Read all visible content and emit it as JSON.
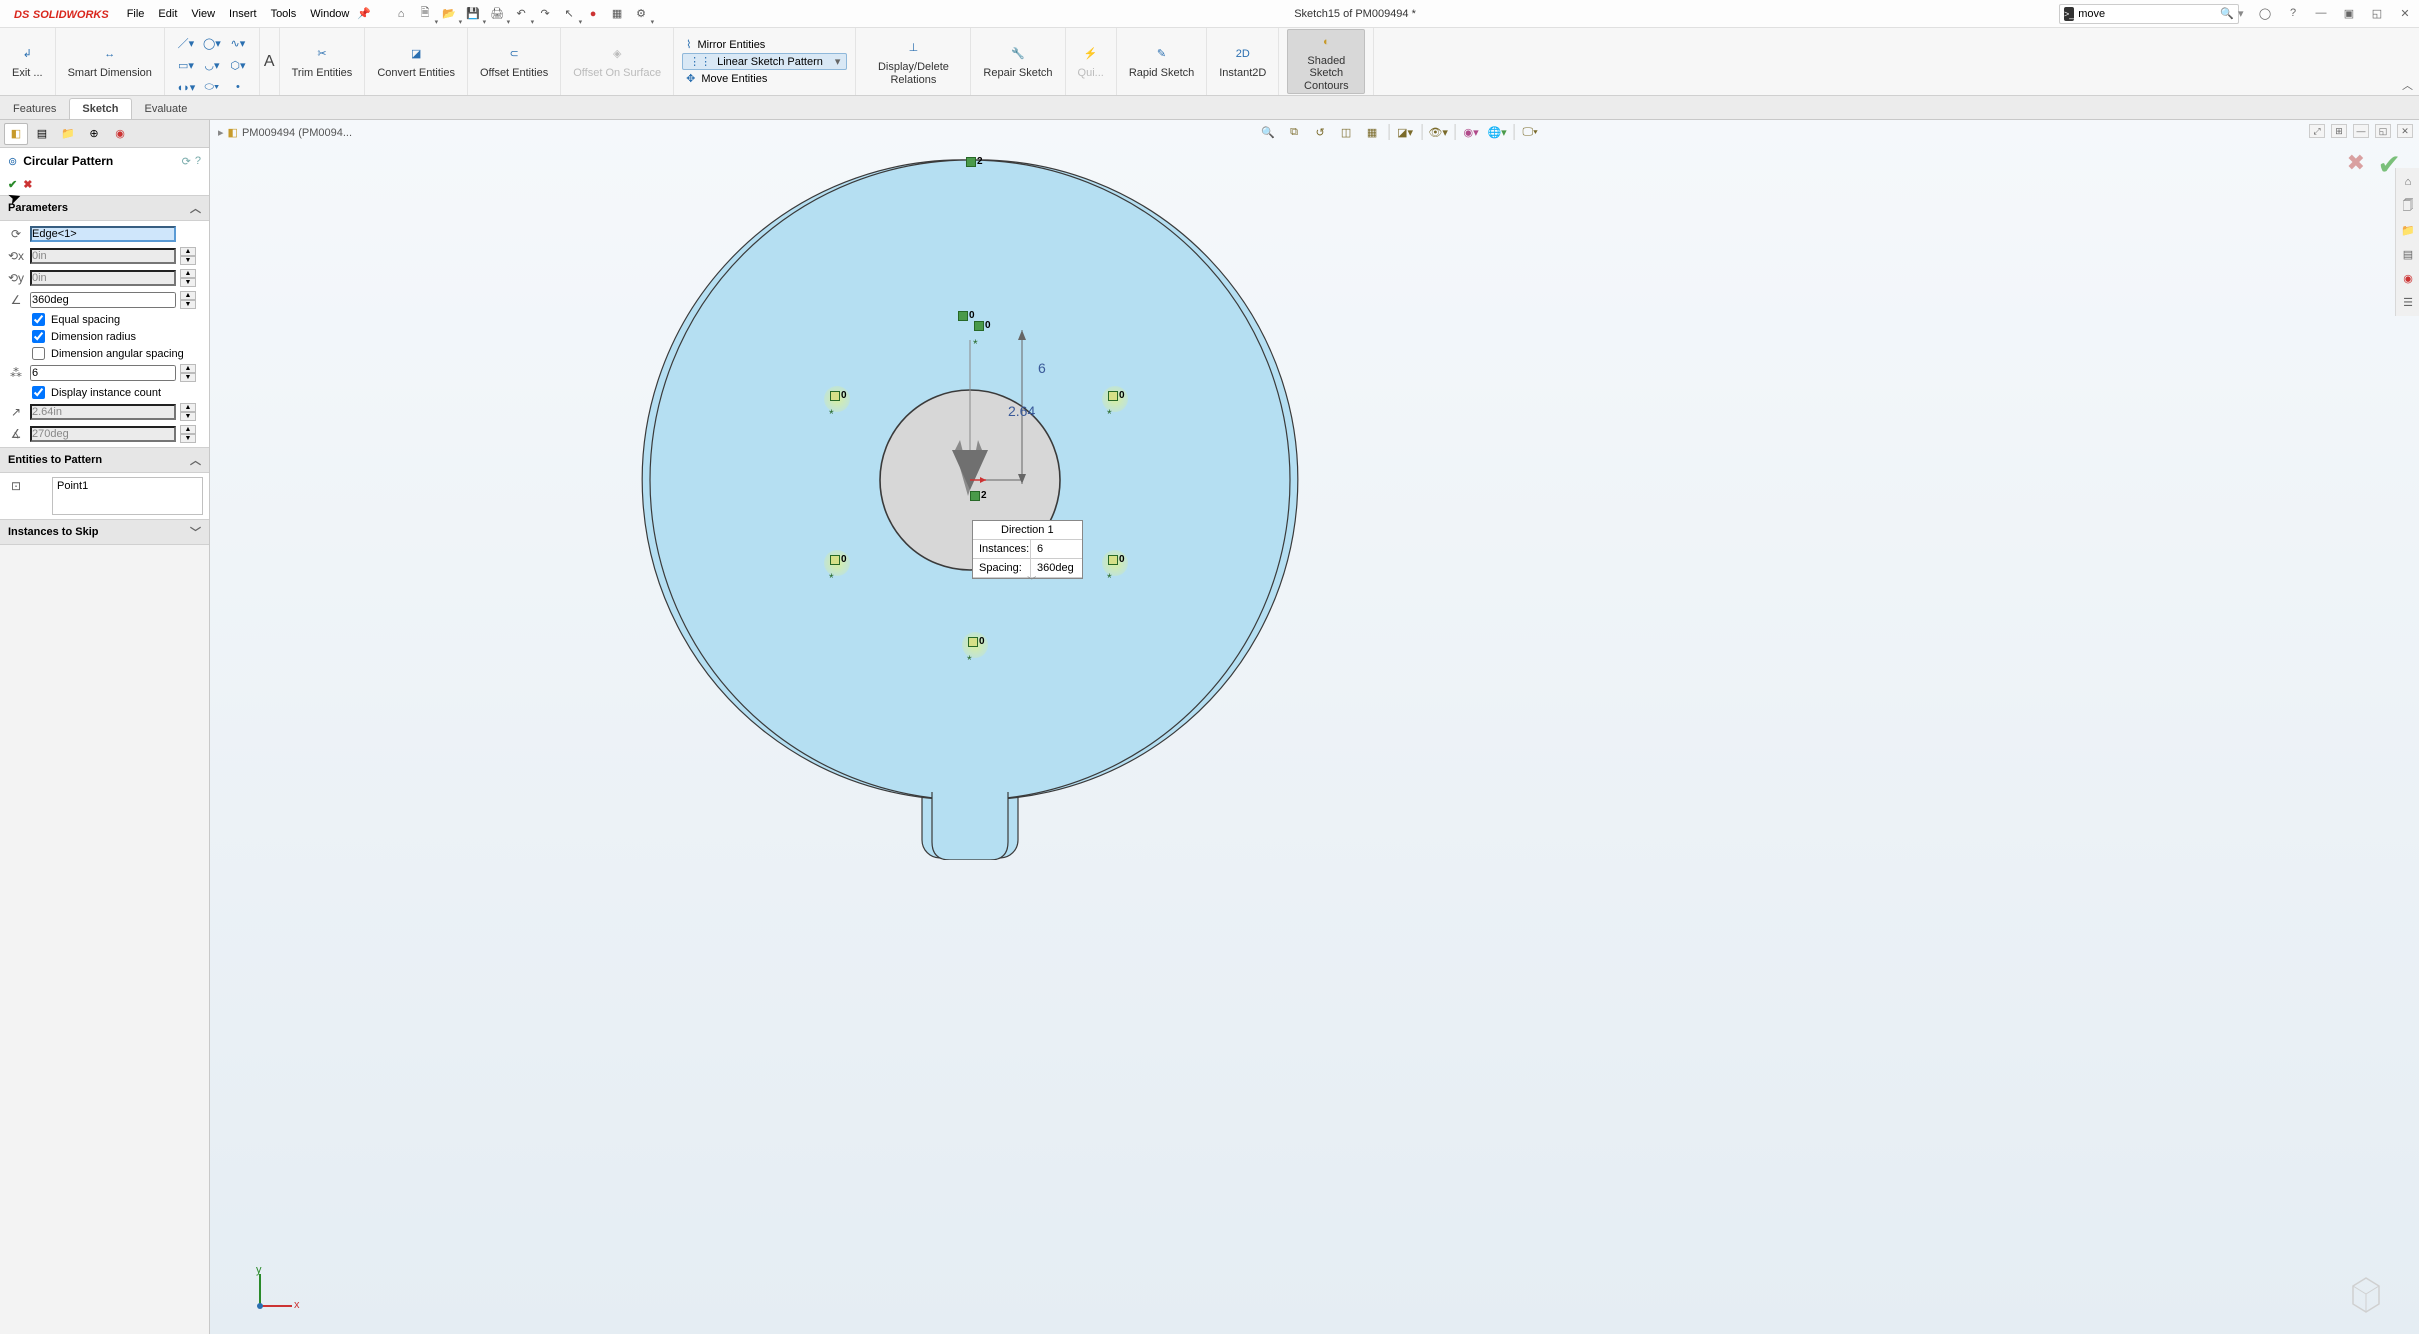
{
  "app": {
    "logo_prefix": "DS",
    "logo_name": "SOLIDWORKS"
  },
  "menu": [
    "File",
    "Edit",
    "View",
    "Insert",
    "Tools",
    "Window"
  ],
  "doc_title": "Sketch15 of PM009494 *",
  "search": {
    "value": "move"
  },
  "ribbon": {
    "exit": "Exit ...",
    "smart_dim": "Smart Dimension",
    "trim": "Trim Entities",
    "convert": "Convert Entities",
    "offset": "Offset Entities",
    "offset_surface": "Offset On Surface",
    "mirror": "Mirror Entities",
    "linear_pattern": "Linear Sketch Pattern",
    "move": "Move Entities",
    "relations": "Display/Delete Relations",
    "repair": "Repair Sketch",
    "quick": "Qui...",
    "rapid": "Rapid Sketch",
    "instant": "Instant2D",
    "shaded": "Shaded Sketch Contours"
  },
  "tabs": [
    "Features",
    "Sketch",
    "Evaluate"
  ],
  "active_tab": "Sketch",
  "breadcrumb": "PM009494 (PM0094...",
  "pm": {
    "title": "Circular Pattern",
    "sections": {
      "parameters": "Parameters",
      "entities": "Entities to Pattern",
      "skip": "Instances to Skip"
    },
    "axis": "Edge<1>",
    "offset_x": "0in",
    "offset_y": "0in",
    "angle": "360deg",
    "equal_spacing": "Equal spacing",
    "dim_radius": "Dimension radius",
    "dim_ang": "Dimension angular spacing",
    "instances": "6",
    "display_count": "Display instance count",
    "radius": "2.64in",
    "start_angle": "270deg",
    "entity_item": "Point1"
  },
  "callout": {
    "title": "Direction 1",
    "instances_label": "Instances:",
    "instances_value": "6",
    "spacing_label": "Spacing:",
    "spacing_value": "360deg"
  },
  "dims": {
    "radial": "2.64",
    "vert": "6"
  },
  "markers": {
    "top": "2",
    "pt": "0",
    "origin": "2"
  }
}
